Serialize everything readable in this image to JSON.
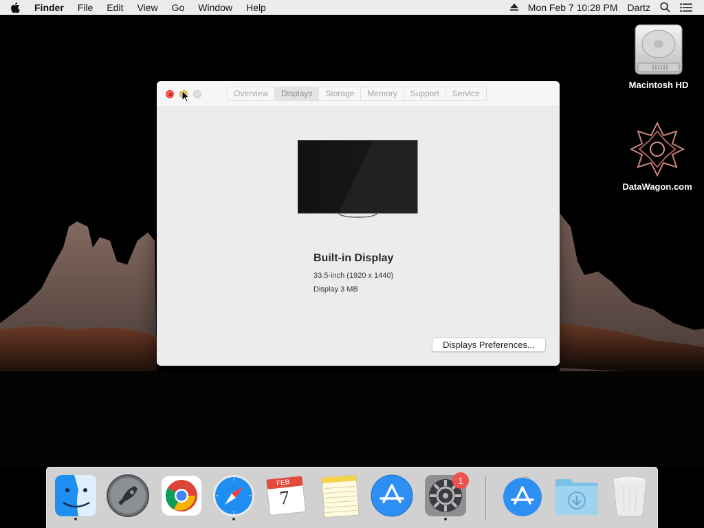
{
  "menubar": {
    "app_name": "Finder",
    "items": [
      "File",
      "Edit",
      "View",
      "Go",
      "Window",
      "Help"
    ],
    "datetime": "Mon Feb 7  10:28 PM",
    "user": "Dartz"
  },
  "desktop": {
    "icons": [
      {
        "label": "Macintosh HD",
        "icon": "hard-drive-icon"
      },
      {
        "label": "DataWagon.com",
        "icon": "datawagon-logo-icon"
      }
    ]
  },
  "window": {
    "tabs": [
      "Overview",
      "Displays",
      "Storage",
      "Memory",
      "Support",
      "Service"
    ],
    "active_tab": "Displays",
    "display": {
      "name": "Built-in Display",
      "size_resolution": "33.5-inch (1920 x 1440)",
      "memory": "Display 3 MB"
    },
    "prefs_button": "Displays Preferences..."
  },
  "dock": {
    "items": [
      {
        "name": "Finder",
        "icon": "finder-icon",
        "running": true
      },
      {
        "name": "Launchpad",
        "icon": "launchpad-icon",
        "running": false
      },
      {
        "name": "Google Chrome",
        "icon": "chrome-icon",
        "running": false
      },
      {
        "name": "Safari",
        "icon": "safari-icon",
        "running": true
      },
      {
        "name": "Calendar",
        "icon": "calendar-icon",
        "running": false,
        "month": "FEB",
        "day": "7"
      },
      {
        "name": "Notes",
        "icon": "notes-icon",
        "running": false
      },
      {
        "name": "App Store",
        "icon": "app-store-icon",
        "running": false
      },
      {
        "name": "System Preferences",
        "icon": "system-preferences-icon",
        "running": true,
        "badge": "1"
      },
      {
        "name": "App Store Installer",
        "icon": "app-store-installer-icon",
        "running": false
      },
      {
        "name": "Downloads",
        "icon": "downloads-folder-icon",
        "running": false
      },
      {
        "name": "Trash",
        "icon": "trash-icon",
        "running": false
      }
    ]
  },
  "colors": {
    "close": "#fc5b57",
    "minimize": "#e5bf3c",
    "badge": "#f0514c",
    "accent_blue": "#1f8ef1"
  }
}
